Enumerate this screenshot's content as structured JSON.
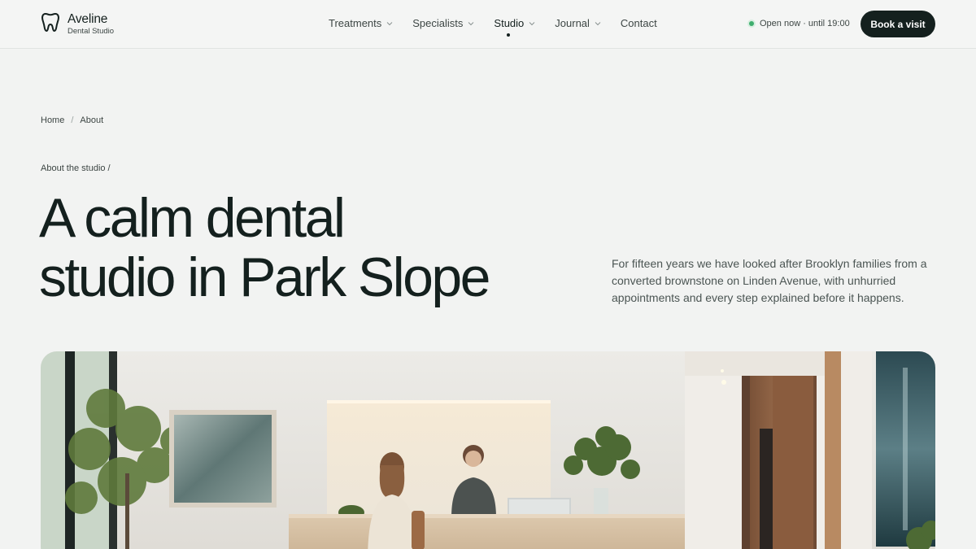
{
  "brand": {
    "name": "Aveline",
    "subtitle": "Dental Studio",
    "icon": "tooth-icon"
  },
  "nav": {
    "items": [
      {
        "label": "Treatments",
        "has_dropdown": true,
        "active": false
      },
      {
        "label": "Specialists",
        "has_dropdown": true,
        "active": false
      },
      {
        "label": "Studio",
        "has_dropdown": true,
        "active": true
      },
      {
        "label": "Journal",
        "has_dropdown": true,
        "active": false
      },
      {
        "label": "Contact",
        "has_dropdown": false,
        "active": false
      }
    ]
  },
  "status": {
    "text": "Open now · until 19:00",
    "color": "#3fae6e"
  },
  "cta": {
    "label": "Book a visit"
  },
  "breadcrumb": {
    "items": [
      "Home",
      "About"
    ],
    "separator": "/"
  },
  "hero": {
    "eyebrow": "About the studio /",
    "title_line1": "A calm dental",
    "title_line2": "studio in Park Slope",
    "lede": "For fifteen years we have looked after Brooklyn families from a converted brownstone on Linden Avenue, with unhurried appointments and every step explained before it happens."
  },
  "colors": {
    "background": "#f2f3f2",
    "ink": "#14201e",
    "muted": "#3d4644"
  }
}
